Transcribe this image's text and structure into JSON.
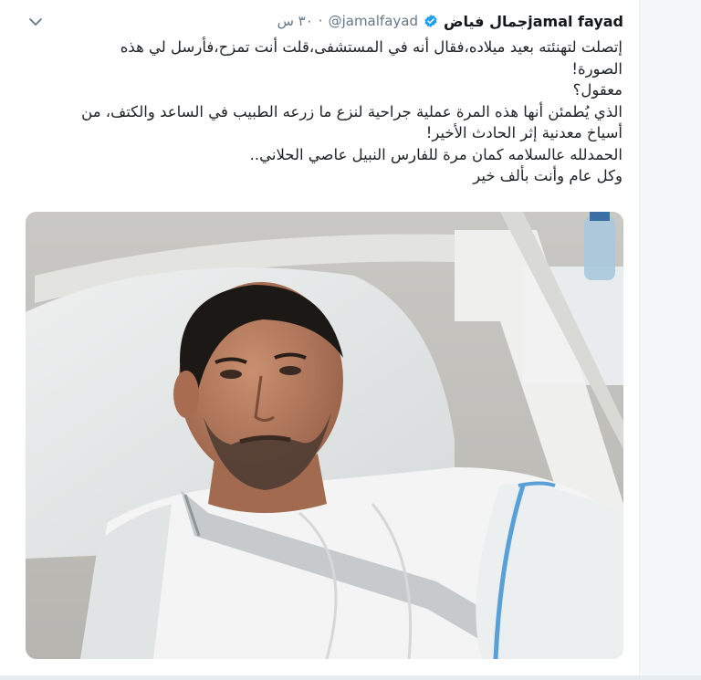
{
  "tweet": {
    "display_name": "jamal fayadجمال فياض",
    "handle": "@jamalfayad",
    "separator": "·",
    "time": "٣٠ س",
    "body_lines": [
      "إتصلت لتهنئته بعيد ميلاده،فقال أنه في المستشفى،قلت أنت تمزح،فأرسل لي هذه",
      "الصورة!",
      "معقول؟",
      "الذي يُطمئن أنها هذه المرة عملية جراحية لنزع ما زرعه الطبيب في الساعد والكتف، من",
      "أسياخ معدنية إثر الحادث الأخير!",
      "الحمدلله عالسلامه كمان مرة للفارس النبيل عاصي الحلاني..",
      "وكل عام وأنت بألف خير"
    ]
  },
  "icons": {
    "verified": "verified-badge-icon",
    "menu": "chevron-down-icon"
  },
  "colors": {
    "verified_blue": "#1da1f2",
    "secondary_text": "#657786",
    "sling_blue": "#5aa0d8"
  }
}
